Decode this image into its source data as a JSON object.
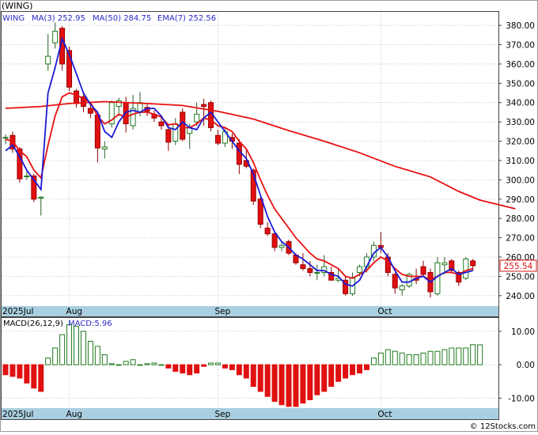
{
  "title": "(WING)",
  "legend": [
    {
      "label": "WING",
      "value": "",
      "color": "#2a2ac8"
    },
    {
      "label": "MA(3)",
      "value": "252.95",
      "color": "#2a2ac8"
    },
    {
      "label": "MA(50)",
      "value": "284.75",
      "color": "#2a2ac8"
    },
    {
      "label": "EMA(7)",
      "value": "252.56",
      "color": "#2a2ac8"
    }
  ],
  "price_tag": "255.54",
  "macd_label": "MACD(26,12,9)",
  "macd_value_label": "MACD:5.96",
  "watermark": "© 12Stocks.com",
  "colors": {
    "up": "#1f7a1f",
    "down": "#e01010",
    "ma": "#1a1ad6",
    "ema": "#e81010",
    "ma50": "#e81010",
    "date_band": "#a9cfe0"
  },
  "chart_data": [
    {
      "type": "candlestick",
      "ylim": [
        235,
        387
      ],
      "y_ticks": [
        240,
        250,
        260,
        270,
        280,
        290,
        300,
        310,
        320,
        330,
        340,
        350,
        360,
        370,
        380
      ],
      "y_tick_labels": [
        "240.00",
        "250.00",
        "260.00",
        "270.00",
        "280.00",
        "290.00",
        "300.00",
        "310.00",
        "320.00",
        "330.00",
        "340.00",
        "350.00",
        "360.00",
        "370.00",
        "380.00"
      ],
      "x_labels": [
        {
          "label": "2025Jul",
          "index": 0
        },
        {
          "label": "Aug",
          "index": 9
        },
        {
          "label": "Sep",
          "index": 30
        },
        {
          "label": "Oct",
          "index": 53
        }
      ],
      "ohlc": [
        [
          321.5,
          323.5,
          318.5,
          322.0
        ],
        [
          323.0,
          325.0,
          314.0,
          316.0
        ],
        [
          316.0,
          317.0,
          298.5,
          300.5
        ],
        [
          302.0,
          304.5,
          300.0,
          302.0
        ],
        [
          302.0,
          303.0,
          288.5,
          290.0
        ],
        [
          290.5,
          291.5,
          281.5,
          291.0
        ],
        [
          360.0,
          375.5,
          356.5,
          364.0
        ],
        [
          371.0,
          381.5,
          368.0,
          377.0
        ],
        [
          378.5,
          379.5,
          356.5,
          360.0
        ],
        [
          367.0,
          369.0,
          346.0,
          348.0
        ],
        [
          346.0,
          347.0,
          337.5,
          339.5
        ],
        [
          343.0,
          345.0,
          335.0,
          338.0
        ],
        [
          337.0,
          339.0,
          332.0,
          334.5
        ],
        [
          333.5,
          335.0,
          309.0,
          316.5
        ],
        [
          316.0,
          320.0,
          311.0,
          317.0
        ],
        [
          329.0,
          341.0,
          327.0,
          340.0
        ],
        [
          338.0,
          342.5,
          333.0,
          341.0
        ],
        [
          340.0,
          343.0,
          324.5,
          329.0
        ],
        [
          328.0,
          344.0,
          326.0,
          337.0
        ],
        [
          335.0,
          345.5,
          333.0,
          340.0
        ],
        [
          337.5,
          340.0,
          333.0,
          335.5
        ],
        [
          334.0,
          336.0,
          330.0,
          332.0
        ],
        [
          330.0,
          333.0,
          326.0,
          328.0
        ],
        [
          326.0,
          329.0,
          315.0,
          319.5
        ],
        [
          320.0,
          332.0,
          318.0,
          329.0
        ],
        [
          335.0,
          337.0,
          320.0,
          321.0
        ],
        [
          324.0,
          329.0,
          316.0,
          327.0
        ],
        [
          330.0,
          340.0,
          328.0,
          334.0
        ],
        [
          339.0,
          342.0,
          328.0,
          338.0
        ],
        [
          340.0,
          341.0,
          325.0,
          327.0
        ],
        [
          323.0,
          326.0,
          318.0,
          319.0
        ],
        [
          319.0,
          327.0,
          317.0,
          325.0
        ],
        [
          322.0,
          324.0,
          316.0,
          320.0
        ],
        [
          319.0,
          321.0,
          303.0,
          308.0
        ],
        [
          310.0,
          316.0,
          306.0,
          307.0
        ],
        [
          305.0,
          306.0,
          287.0,
          289.0
        ],
        [
          290.0,
          291.0,
          275.0,
          277.0
        ],
        [
          275.0,
          278.0,
          271.0,
          272.0
        ],
        [
          272.0,
          273.0,
          263.0,
          265.0
        ],
        [
          265.0,
          268.0,
          263.0,
          266.0
        ],
        [
          268.0,
          269.0,
          261.0,
          262.0
        ],
        [
          261.0,
          262.0,
          256.0,
          257.0
        ],
        [
          256.0,
          262.0,
          253.0,
          254.0
        ],
        [
          254.0,
          258.0,
          250.0,
          252.0
        ],
        [
          252.0,
          256.0,
          248.0,
          252.0
        ],
        [
          252.0,
          261.0,
          250.0,
          255.0
        ],
        [
          252.0,
          255.0,
          248.0,
          248.0
        ],
        [
          248.0,
          254.0,
          247.0,
          249.0
        ],
        [
          248.0,
          250.0,
          240.0,
          241.0
        ],
        [
          241.0,
          252.0,
          240.0,
          249.0
        ],
        [
          252.0,
          256.0,
          250.0,
          255.0
        ],
        [
          255.0,
          262.0,
          252.0,
          260.0
        ],
        [
          260.0,
          268.0,
          258.0,
          266.0
        ],
        [
          266.0,
          273.0,
          262.0,
          265.0
        ],
        [
          260.0,
          262.0,
          250.0,
          252.0
        ],
        [
          251.0,
          252.0,
          241.0,
          244.0
        ],
        [
          243.0,
          246.0,
          240.0,
          245.0
        ],
        [
          245.0,
          252.0,
          244.0,
          251.0
        ],
        [
          249.0,
          254.0,
          246.0,
          248.0
        ],
        [
          255.0,
          258.0,
          250.0,
          251.0
        ],
        [
          252.0,
          254.0,
          239.0,
          242.0
        ],
        [
          241.0,
          260.0,
          240.0,
          257.0
        ],
        [
          256.0,
          260.0,
          251.0,
          257.0
        ],
        [
          258.0,
          259.0,
          252.0,
          253.0
        ],
        [
          252.0,
          253.0,
          245.0,
          247.0
        ],
        [
          249.0,
          260.0,
          248.0,
          259.0
        ],
        [
          258.0,
          259.0,
          253.0,
          255.5
        ]
      ],
      "ma3": [
        315.0,
        318.0,
        312.0,
        305.0,
        300.0,
        295.0,
        345.0,
        358.0,
        373.0,
        365.0,
        355.0,
        345.0,
        339.0,
        335.0,
        325.0,
        322.0,
        330.0,
        335.0,
        336.0,
        335.0,
        337.0,
        337.0,
        333.0,
        327.0,
        326.0,
        330.0,
        327.0,
        326.0,
        332.0,
        335.0,
        330.0,
        325.0,
        320.0,
        315.0,
        311.0,
        303.0,
        292.0,
        281.0,
        273.0,
        268.0,
        265.0,
        261.0,
        259.0,
        256.0,
        253.0,
        253.0,
        251.0,
        250.0,
        246.0,
        245.0,
        248.0,
        255.0,
        262.0,
        265.0,
        260.0,
        253.0,
        247.0,
        247.0,
        249.0,
        250.0,
        247.0,
        250.0,
        252.0,
        254.0,
        251.0,
        252.0,
        253.0
      ],
      "ema7": [
        321.0,
        320.0,
        315.0,
        312.0,
        305.0,
        301.0,
        318.0,
        333.0,
        343.0,
        345.0,
        344.0,
        342.0,
        340.0,
        333.0,
        329.0,
        331.0,
        334.0,
        332.5,
        334.0,
        335.0,
        335.0,
        334.0,
        332.5,
        328.5,
        329.0,
        327.0,
        327.0,
        329.0,
        332.0,
        331.0,
        328.0,
        327.0,
        325.0,
        320.0,
        316.0,
        309.0,
        300.0,
        292.0,
        285.0,
        280.0,
        275.0,
        270.0,
        266.0,
        262.0,
        259.0,
        258.0,
        256.0,
        254.0,
        250.0,
        249.0,
        251.0,
        253.0,
        257.0,
        260.0,
        258.0,
        254.0,
        251.0,
        250.0,
        250.0,
        250.0,
        248.0,
        250.0,
        252.0,
        252.0,
        251.0,
        253.0,
        254.0
      ],
      "ma50": [
        [
          0,
          337.0
        ],
        [
          5,
          338.0
        ],
        [
          9,
          339.5
        ],
        [
          14,
          340.5
        ],
        [
          20,
          339.5
        ],
        [
          25,
          338.5
        ],
        [
          30,
          335.5
        ],
        [
          35,
          331.5
        ],
        [
          40,
          325.5
        ],
        [
          45,
          320.0
        ],
        [
          50,
          314.0
        ],
        [
          55,
          307.0
        ],
        [
          60,
          301.5
        ],
        [
          64,
          294.0
        ],
        [
          67,
          289.5
        ],
        [
          72,
          285.0
        ]
      ]
    },
    {
      "type": "bar",
      "name": "MACD(26,12,9)",
      "ylim": [
        -13,
        14
      ],
      "y_ticks": [
        -10,
        0,
        10
      ],
      "y_tick_labels": [
        "-10.00",
        "0.00",
        "10.00"
      ],
      "values": [
        -3.0,
        -3.5,
        -4.0,
        -5.5,
        -7.0,
        -8.0,
        2.0,
        5.0,
        9.0,
        12.0,
        11.5,
        10.0,
        7.0,
        5.5,
        3.0,
        0.3,
        0.0,
        1.0,
        1.5,
        0.0,
        0.3,
        0.5,
        0.0,
        -1.0,
        -2.0,
        -2.5,
        -3.0,
        -2.5,
        -0.5,
        0.5,
        0.5,
        -1.0,
        -1.5,
        -3.0,
        -4.0,
        -6.5,
        -8.0,
        -9.5,
        -11.0,
        -12.0,
        -12.5,
        -12.5,
        -11.5,
        -10.5,
        -9.0,
        -8.0,
        -6.5,
        -5.0,
        -4.0,
        -3.0,
        -2.5,
        -1.5,
        2.0,
        3.5,
        4.5,
        4.0,
        3.5,
        3.0,
        3.0,
        3.5,
        4.0,
        4.0,
        4.5,
        5.0,
        5.0,
        5.0,
        6.0,
        5.96
      ]
    }
  ]
}
